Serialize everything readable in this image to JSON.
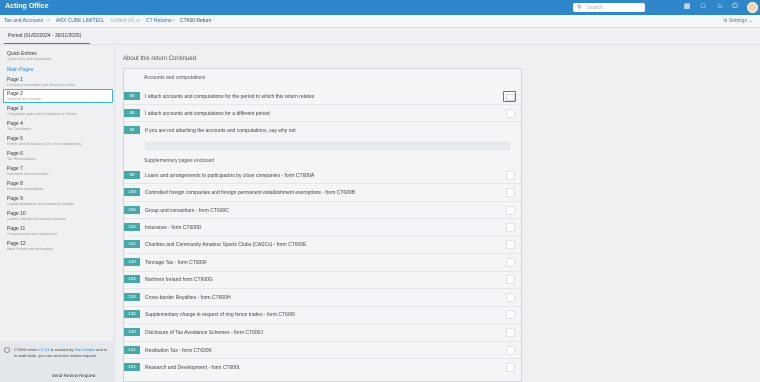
{
  "app": {
    "title": "Acting Office"
  },
  "topbar": {
    "search_placeholder": "Search",
    "icons": [
      "search-icon",
      "grid-icon",
      "document-icon",
      "bell-icon",
      "power-icon"
    ]
  },
  "breadcrumb": {
    "items": [
      "Tax and Accounts",
      "ARX CUBE LIMITED",
      "Unfiled (4) ∧",
      "CT Returns",
      "CT600 Return"
    ],
    "settings_label": "Settings"
  },
  "period_tab": "Period (01/02/2024 - 30/11/2025)",
  "sidebar": {
    "quick_entries_title": "Quick Entries",
    "quick_entries_sub": "Quick entry and submission",
    "main_pages": "Main Pages",
    "pages": [
      {
        "title": "Page 1",
        "sub": "Company information and About this return"
      },
      {
        "title": "Page 2",
        "sub": "Turnover and Income"
      },
      {
        "title": "Page 3",
        "sub": "Chargeable gains and Deductions & Reliefs"
      },
      {
        "title": "Page 4",
        "sub": "Tax Calculation"
      },
      {
        "title": "Page 5",
        "sub": "Reliefs and deductions (Ctr) of tax outstanding"
      },
      {
        "title": "Page 6",
        "sub": "Tax Reconciliation"
      },
      {
        "title": "Page 7",
        "sub": "Indicators and Information"
      },
      {
        "title": "Page 8",
        "sub": "Enhanced expenditure"
      },
      {
        "title": "Page 9",
        "sub": "Capital allowances and balancing charges"
      },
      {
        "title": "Page 10",
        "sub": "Losses, deficits and excess amounts"
      },
      {
        "title": "Page 11",
        "sub": "Overpayments and repayments"
      },
      {
        "title": "Page 12",
        "sub": "Bank Details and declaration"
      }
    ],
    "footer": {
      "text_1": "CT600 return ",
      "link_1": "CT-23",
      "text_2": " is created by ",
      "link_2": "Paul Dalton",
      "text_3": " and is in draft state, you can send the review request.",
      "button": "Send Review Request"
    }
  },
  "main": {
    "heading": "About this return Continued",
    "section_accounts": "Accounts and computations",
    "rows_accounts": [
      {
        "num": "80",
        "label": "I attach accounts and computations for the period to which this return relates"
      },
      {
        "num": "85",
        "label": "I attach accounts and computations for a different period"
      },
      {
        "num": "90",
        "label": "If you are not attaching the accounts and computations, say why not"
      }
    ],
    "section_supplementary": "Supplementary pages enclosed",
    "rows_supplementary": [
      {
        "num": "95",
        "label": "Loans and arrangements to participators by close companies - form CT600A"
      },
      {
        "num": "100",
        "label": "Controlled foreign companies and foreign permanent establishment exemptions - form CT600B"
      },
      {
        "num": "105",
        "label": "Group and consortium - form CT600C"
      },
      {
        "num": "110",
        "label": "Insurance - form CT600D"
      },
      {
        "num": "115",
        "label": "Charities and Community Amateur Sports Clubs (CASCs) - form CT600E"
      },
      {
        "num": "120",
        "label": "Tonnage Tax - form CT600F"
      },
      {
        "num": "125",
        "label": "Northern Ireland form CT600G"
      },
      {
        "num": "130",
        "label": "Cross-border Royalties - form CT600H"
      },
      {
        "num": "135",
        "label": "Supplementary charge in respect of ring fence trades - form CT600I"
      },
      {
        "num": "140",
        "label": "Disclosure of Tax Avoidance Schemes - form CT600J"
      },
      {
        "num": "141",
        "label": "Restitution Tax - form CT600K"
      },
      {
        "num": "142",
        "label": "Research and Development - form CT600L"
      }
    ]
  },
  "colors": {
    "brand": "#2f86c8",
    "row_number": "#48a8a8",
    "focus": "#38b5e8"
  }
}
